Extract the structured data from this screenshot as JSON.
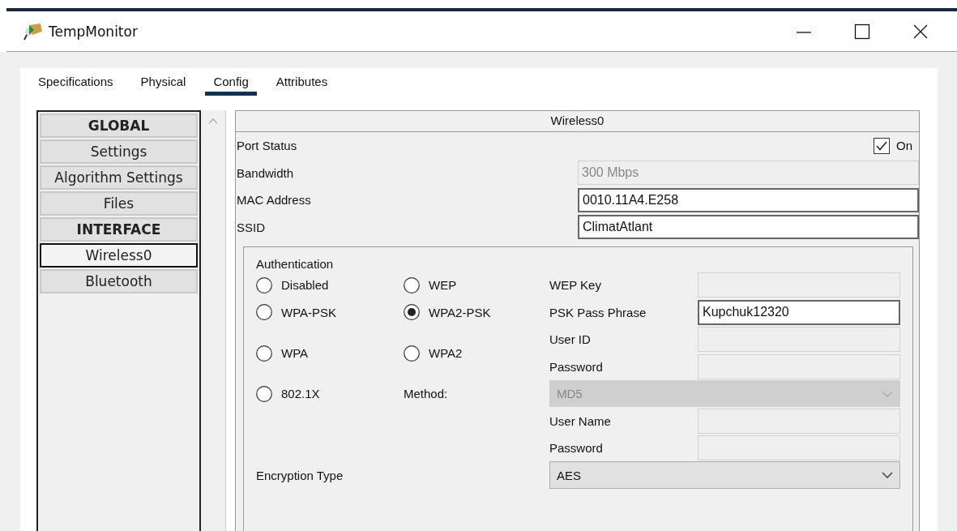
{
  "window": {
    "title": "TempMonitor"
  },
  "tabs": [
    {
      "label": "Specifications",
      "selected": false
    },
    {
      "label": "Physical",
      "selected": false
    },
    {
      "label": "Config",
      "selected": true
    },
    {
      "label": "Attributes",
      "selected": false
    }
  ],
  "sidebar": {
    "items": [
      {
        "label": "GLOBAL",
        "kind": "header",
        "selected": false
      },
      {
        "label": "Settings",
        "kind": "item",
        "selected": false
      },
      {
        "label": "Algorithm Settings",
        "kind": "item",
        "selected": false
      },
      {
        "label": "Files",
        "kind": "item",
        "selected": false
      },
      {
        "label": "INTERFACE",
        "kind": "header",
        "selected": false
      },
      {
        "label": "Wireless0",
        "kind": "item",
        "selected": true
      },
      {
        "label": "Bluetooth",
        "kind": "item",
        "selected": false
      }
    ]
  },
  "panel": {
    "title": "Wireless0",
    "port_status": {
      "label": "Port Status",
      "checked": true,
      "checkbox_label": "On"
    },
    "fields": [
      {
        "label": "Bandwidth",
        "value": "300 Mbps",
        "disabled": true
      },
      {
        "label": "MAC Address",
        "value": "0010.11A4.E258",
        "disabled": false
      },
      {
        "label": "SSID",
        "value": "ClimatAtlant",
        "disabled": false
      }
    ],
    "authentication": {
      "title": "Authentication",
      "options": [
        {
          "label": "Disabled",
          "selected": false
        },
        {
          "label": "WEP",
          "selected": false
        },
        {
          "label": "WPA-PSK",
          "selected": false
        },
        {
          "label": "WPA2-PSK",
          "selected": true
        },
        {
          "label": "WPA",
          "selected": false
        },
        {
          "label": "WPA2",
          "selected": false
        },
        {
          "label": "802.1X",
          "selected": false
        }
      ],
      "credentials": [
        {
          "label": "WEP Key",
          "disabled": true
        },
        {
          "label": "PSK Pass Phrase",
          "value": "Kupchuk12320",
          "disabled": false
        },
        {
          "label": "User ID",
          "disabled": true
        },
        {
          "label": "Password",
          "disabled": true
        },
        {
          "label": "User Name",
          "disabled": true
        },
        {
          "label": "Password",
          "disabled": true
        }
      ],
      "method": {
        "label": "Method:",
        "value": "MD5",
        "disabled": true
      },
      "encryption": {
        "label": "Encryption Type",
        "value": "AES",
        "disabled": false
      }
    }
  }
}
